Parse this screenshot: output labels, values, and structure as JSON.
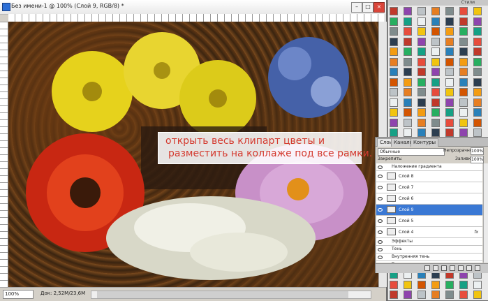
{
  "document": {
    "title": "Без имени-1 @ 100% (Слой 9, RGB/8) *",
    "zoom": "100%",
    "doc_size": "Док: 2,52M/23,6M",
    "caption_line1": "открыть весь клипарт цветы и",
    "caption_line2": "разместить на коллаже под все рамки."
  },
  "swatches_title": "Стили",
  "layers": {
    "tabs": [
      "Слои",
      "Каналы",
      "Контуры"
    ],
    "blend_mode": "Обычные",
    "opacity_label": "Непрозрачность:",
    "opacity_value": "100%",
    "lock_label": "Закрепить:",
    "fill_label": "Заливка:",
    "fill_value": "100%",
    "items": [
      {
        "name": "Наложение градиента",
        "type": "effect"
      },
      {
        "name": "Слой 8",
        "type": "layer"
      },
      {
        "name": "Слой 7",
        "type": "layer"
      },
      {
        "name": "Слой 6",
        "type": "layer"
      },
      {
        "name": "Слой 9",
        "type": "layer",
        "selected": true
      },
      {
        "name": "Слой 5",
        "type": "layer"
      },
      {
        "name": "Слой 4",
        "type": "layer",
        "fx": "fx"
      },
      {
        "name": "Эффекты",
        "type": "effect-group"
      },
      {
        "name": "Тень",
        "type": "effect"
      },
      {
        "name": "Внутренняя тень",
        "type": "effect"
      },
      {
        "name": "Тиснение",
        "type": "effect"
      }
    ]
  },
  "colors": {
    "caption_text": "#d43a2f",
    "selected_layer": "#3a78d4"
  }
}
